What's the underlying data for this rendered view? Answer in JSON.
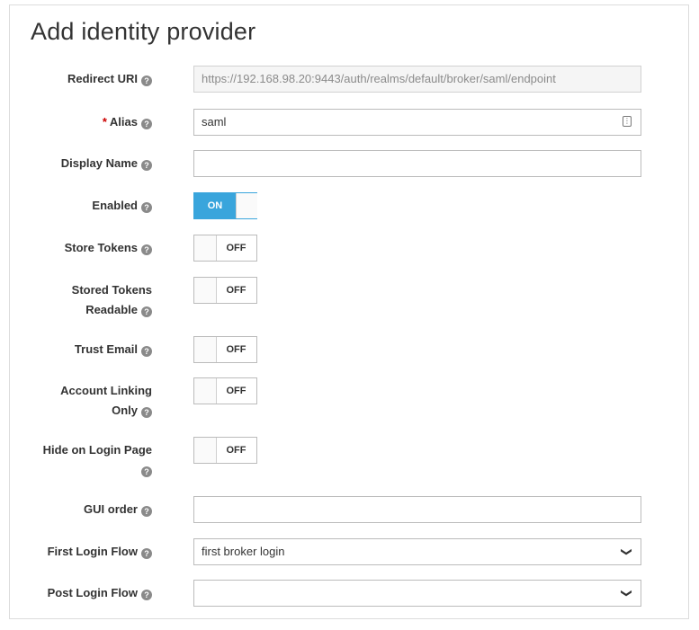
{
  "title": "Add identity provider",
  "fields": {
    "redirect_uri": {
      "label": "Redirect URI",
      "value": "https://192.168.98.20:9443/auth/realms/default/broker/saml/endpoint"
    },
    "alias": {
      "required_mark": "*",
      "label": "Alias",
      "value": "saml"
    },
    "display_name": {
      "label": "Display Name",
      "value": ""
    },
    "enabled": {
      "label": "Enabled",
      "state": "ON"
    },
    "store_tokens": {
      "label": "Store Tokens",
      "state": "OFF"
    },
    "stored_tokens_readable": {
      "label_line1": "Stored Tokens",
      "label_line2": "Readable",
      "state": "OFF"
    },
    "trust_email": {
      "label": "Trust Email",
      "state": "OFF"
    },
    "account_linking_only": {
      "label_line1": "Account Linking",
      "label_line2": "Only",
      "state": "OFF"
    },
    "hide_on_login_page": {
      "label": "Hide on Login Page",
      "state": "OFF"
    },
    "gui_order": {
      "label": "GUI order",
      "value": ""
    },
    "first_login_flow": {
      "label": "First Login Flow",
      "selected": "first broker login"
    },
    "post_login_flow": {
      "label": "Post Login Flow",
      "selected": ""
    }
  },
  "icons": {
    "help": "question-circle-icon",
    "caret": "chevron-down-icon",
    "field_action": "keypad-icon"
  },
  "colors": {
    "toggle_on": "#39a5dc",
    "required": "#cc0000"
  }
}
